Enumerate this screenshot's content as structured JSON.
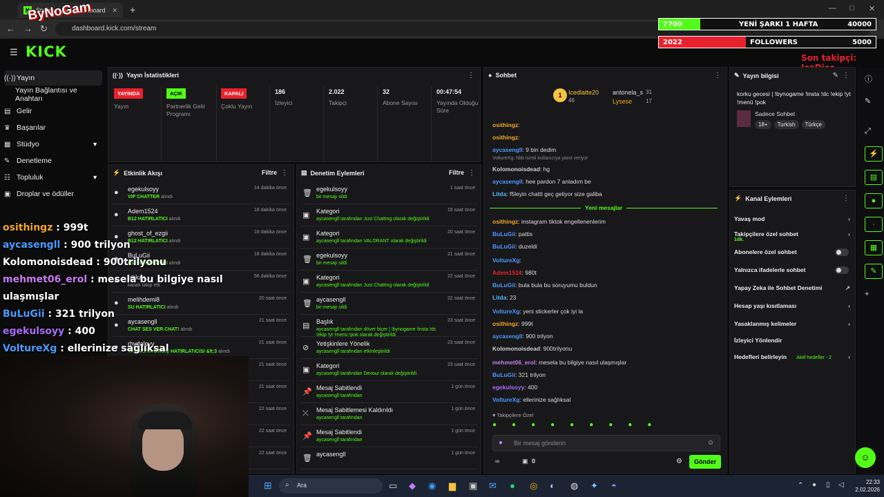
{
  "browser": {
    "tab_title": "Stream - Kick Dashboard",
    "url": "dashboard.kick.com/stream"
  },
  "overlay": {
    "logo": "ByNoGam",
    "song_bar": {
      "left": "7700",
      "center": "YENİ ŞARKI 1 HAFTA",
      "right": "40000",
      "progress": 0.1925,
      "color": "#53fc18"
    },
    "follow_bar": {
      "left": "2022",
      "center": "FOLLOWERS",
      "right": "5000",
      "progress": 0.4,
      "color": "#e8222d"
    },
    "last_follower": "Son takipçi: IceDice",
    "chat": [
      {
        "user": "osithingz",
        "text": " : 999t",
        "color": "#f5a623"
      },
      {
        "user": "aycasengll",
        "text": " : 900 trilyon",
        "color": "#4a9bff"
      },
      {
        "user": "Kolomonoisdead",
        "text": " : 900trilyonu",
        "color": "#ffffff"
      },
      {
        "user": "mehmet06_erol",
        "text": " : mesela bu bilgiye nasıl",
        "color": "#c97cf2"
      },
      {
        "user": "",
        "text": "ulaşmışlar",
        "color": "#fff"
      },
      {
        "user": "BuLuGii",
        "text": " : 321 trilyon",
        "color": "#4a9bff"
      },
      {
        "user": "egekulsoyy",
        "text": " : 400",
        "color": "#a96cf6"
      },
      {
        "user": "VoltureXg",
        "text": " : ellerinize sağlıksal",
        "color": "#4a9bff"
      }
    ]
  },
  "sidebar": {
    "items": [
      {
        "label": "Yayın",
        "icon": "broadcast-icon"
      },
      {
        "label": "Yayın Bağlantısı ve Anahtarı",
        "icon": ""
      },
      {
        "label": "Gelir",
        "icon": "money-icon"
      },
      {
        "label": "Başarılar",
        "icon": "trophy-icon"
      },
      {
        "label": "Stüdyo",
        "icon": "studio-icon"
      },
      {
        "label": "Denetleme",
        "icon": "wrench-icon"
      },
      {
        "label": "Topluluk",
        "icon": "community-icon"
      },
      {
        "label": "Droplar ve ödüller",
        "icon": "gift-icon"
      }
    ]
  },
  "stats": {
    "title": "Yayın İstatistikleri",
    "cols": [
      {
        "badge": "YAYINDA",
        "badge_color": "#e8222d",
        "label": "Yayın"
      },
      {
        "badge": "AÇIK",
        "badge_color": "#53fc18",
        "label": "Partnerlik Gelir Programı"
      },
      {
        "badge": "KAPALI",
        "badge_color": "#e8222d",
        "label": "Çoklu Yayın"
      },
      {
        "value": "186",
        "label": "İzleyici"
      },
      {
        "value": "2.022",
        "label": "Takipçi"
      },
      {
        "value": "32",
        "label": "Abone Sayısı"
      },
      {
        "value": "00:47:54",
        "label": "Yayında Olduğu Süre"
      }
    ]
  },
  "activity": {
    "title": "Etkinlik Akışı",
    "filter": "Filtre",
    "rows": [
      {
        "t": "egekulsoyy",
        "s": "VIP CHATTER",
        "s2": " alındı",
        "tm": "14 dakika önce"
      },
      {
        "t": "Adem1524",
        "s": "B12 HATIRLATICI",
        "s2": " alındı",
        "tm": "18 dakika önce"
      },
      {
        "t": "ghost_of_ezgii",
        "s": "B12 HATIRLATICI",
        "s2": " alındı",
        "tm": "18 dakika önce"
      },
      {
        "t": "BuLuGii",
        "s": "B12 HATIRLATICI",
        "s2": " alındı",
        "tm": "18 dakika önce"
      },
      {
        "t": "ultikas",
        "s": "",
        "s2": "kanalı takip etti",
        "tm": "56 dakika önce"
      },
      {
        "t": "melihdemi8",
        "s": "SU HATIRLATICI",
        "s2": " alındı",
        "tm": "20 saat önce"
      },
      {
        "t": "aycasengll",
        "s": "CHAT SES VER CHAT!",
        "s2": " alındı",
        "tm": "21 saat önce"
      },
      {
        "t": "rhydaleyy",
        "s": "YAYINCIYA BAĞIŞ HATIRLATICISI &lt;3",
        "s2": " alındı",
        "tm": "21 saat önce"
      },
      {
        "t": "",
        "s": "",
        "s2": "",
        "tm": "21 saat önce"
      },
      {
        "t": "",
        "s": "",
        "s2": "",
        "tm": "21 saat önce"
      },
      {
        "t": "",
        "s": "",
        "s2": "",
        "tm": "22 saat önce"
      },
      {
        "t": "",
        "s": "",
        "s2": "",
        "tm": "22 saat önce"
      },
      {
        "t": "",
        "s": "",
        "s2": "",
        "tm": "22 saat önce"
      }
    ]
  },
  "mod": {
    "title": "Denetim Eylemleri",
    "filter": "Filtre",
    "rows": [
      {
        "ic": "trash-icon",
        "t": "egekulsoyy",
        "s": "bir mesajı sildi",
        "tm": "1 saat önce"
      },
      {
        "ic": "category-icon",
        "t": "Kategori",
        "s": "aycasengll tarafından Just Chatting olarak değiştirildi",
        "tm": "19 saat önce"
      },
      {
        "ic": "category-icon",
        "t": "Kategori",
        "s": "aycasengll tarafından VALORANT olarak değiştirildi",
        "tm": "20 saat önce"
      },
      {
        "ic": "trash-icon",
        "t": "egekulsoyy",
        "s": "bir mesajı sildi",
        "tm": "21 saat önce"
      },
      {
        "ic": "category-icon",
        "t": "Kategori",
        "s": "aycasengll tarafından Just Chatting olarak değiştirildi",
        "tm": "22 saat önce"
      },
      {
        "ic": "trash-icon",
        "t": "aycasengll",
        "s": "bir mesajı sildi",
        "tm": "22 saat önce"
      },
      {
        "ic": "title-icon",
        "t": "Başlık",
        "s": "aycasengll tarafından döver biçer | !bynogame !insta !dc !ekip !yt !menü !pok olarak değiştirildi",
        "tm": "23 saat önce"
      },
      {
        "ic": "mature-icon",
        "t": "Yetişkinlere Yönelik",
        "s": "aycasengll tarafından etkinleştirildi",
        "tm": "23 saat önce"
      },
      {
        "ic": "category-icon",
        "t": "Kategori",
        "s": "aycasengll tarafından Devour olarak değiştirildi",
        "tm": "23 saat önce"
      },
      {
        "ic": "pin-icon",
        "t": "Mesaj Sabitlendi",
        "s": "aycasengll tarafından",
        "tm": "1 gün önce"
      },
      {
        "ic": "unpin-icon",
        "t": "Mesaj Sabitlemesi Kaldırıldı",
        "s": "aycasengll tarafından",
        "tm": "1 gün önce"
      },
      {
        "ic": "pin-icon",
        "t": "Mesaj Sabitlendi",
        "s": "aycasengll tarafından",
        "tm": "1 gün önce"
      },
      {
        "ic": "trash-icon",
        "t": "aycasengll",
        "s": "",
        "tm": "1 gün önce"
      }
    ]
  },
  "chat": {
    "title": "Sohbet",
    "top_gifters": [
      {
        "rank": "1",
        "user": "Icedlatte20",
        "score": "46"
      },
      {
        "user": "antonela_s",
        "score": "31"
      },
      {
        "user": "Lysese",
        "score": "17"
      }
    ],
    "new_messages": "Yeni mesajlar",
    "reply": "VoltureXg: hbb isimli kullanıcıya yanıt veriyor",
    "lines": [
      {
        "u": "osithingz",
        "c": "#f5a623",
        "m": ":"
      },
      {
        "u": "osithingz",
        "c": "#f5a623",
        "m": ":"
      },
      {
        "u": "aycasengll",
        "c": "#4a9bff",
        "m": ": 9 bin dedim"
      },
      {
        "u": "Kolomonoisdead",
        "c": "#cfcfcf",
        "m": ": hg"
      },
      {
        "u": "aycasengll",
        "c": "#4a9bff",
        "m": ": hee pardon 7 anladım be"
      },
      {
        "u": "Litda",
        "c": "#53b7ff",
        "m": ": f5leyin chattt geç geliyor size galiba"
      },
      {
        "u": "osithingz",
        "c": "#f5a623",
        "m": ": instagram tiktok engellenenlerim"
      },
      {
        "u": "BuLuGii",
        "c": "#4a9bff",
        "m": ": pattis"
      },
      {
        "u": "BuLuGii",
        "c": "#4a9bff",
        "m": ": duzeldi"
      },
      {
        "u": "VoltureXg",
        "c": "#4a9bff",
        "m": ":"
      },
      {
        "u": "Adem1524",
        "c": "#e8222d",
        "m": ": 980t"
      },
      {
        "u": "BuLuGii",
        "c": "#4a9bff",
        "m": ": bula bula bu soruyumu buldun"
      },
      {
        "u": "Litda",
        "c": "#53b7ff",
        "m": ": 23"
      },
      {
        "u": "VoltureXg",
        "c": "#4a9bff",
        "m": ": yeni stickerler çok iyi la"
      },
      {
        "u": "osithingz",
        "c": "#f5a623",
        "m": ": 999t"
      },
      {
        "u": "aycasengll",
        "c": "#4a9bff",
        "m": ": 900 trilyon"
      },
      {
        "u": "Kolomonoisdead",
        "c": "#cfcfcf",
        "m": ": 900trilyonu"
      },
      {
        "u": "mehmet06_erol",
        "c": "#c97cf2",
        "m": ": mesela bu bilgiye nasıl ulaşmışlar"
      },
      {
        "u": "BuLuGii",
        "c": "#4a9bff",
        "m": ": 321 trilyon"
      },
      {
        "u": "egekulsoyy",
        "c": "#a96cf6",
        "m": ": 400"
      },
      {
        "u": "VoltureXg",
        "c": "#4a9bff",
        "m": ": ellerinize sağlıksal"
      }
    ],
    "followers_only": "Takipçilere Özel",
    "input_placeholder": "Bir mesaj gönderin",
    "kicks": "0",
    "send": "Gönder"
  },
  "info": {
    "title": "Yayın bilgisi",
    "stream_title": "korku gecesi | !bynogame !insta !dc !ekip !yt !menü !pok",
    "category": "Sadece Sohbet",
    "tags": [
      "18+",
      "Turkish",
      "Türkçe"
    ]
  },
  "channel": {
    "title": "Kanal Eylemleri",
    "items": [
      {
        "l": "Yavaş mod",
        "k": "chev"
      },
      {
        "l": "Takipçilere özel sohbet",
        "sub": "1dk.",
        "k": "chev"
      },
      {
        "l": "Abonelere özel sohbet",
        "k": "tog"
      },
      {
        "l": "Yalnızca ifadelerle sohbet",
        "k": "tog"
      },
      {
        "l": "Yapay Zeka ile Sohbet Denetimi",
        "k": "ext"
      },
      {
        "l": "Hesap yaşı kısıtlaması",
        "k": "chev"
      },
      {
        "l": "Yasaklanmış kelimeler",
        "k": "chev"
      },
      {
        "l": "İzleyici Yönlendir",
        "k": ""
      },
      {
        "l": "Hedefleri belirleyin",
        "sub": "Aktif hedefler - 2",
        "k": "chev"
      }
    ]
  },
  "taskbar": {
    "search": "Ara",
    "time": "22:33",
    "date": "2.02.2026"
  }
}
